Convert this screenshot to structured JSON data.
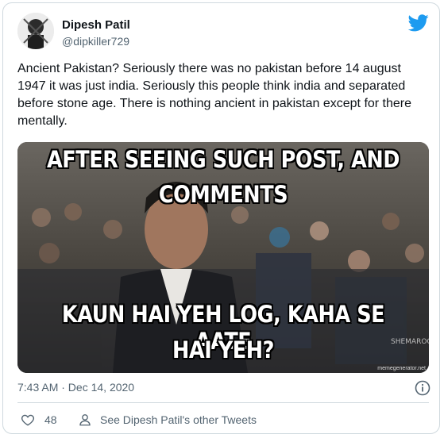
{
  "author": {
    "display_name": "Dipesh Patil",
    "handle": "@dipkiller729",
    "avatar_icon": "avatar-icon"
  },
  "brand": {
    "icon": "twitter-bird-icon",
    "color": "#1d9bf0"
  },
  "tweet": {
    "text": "Ancient Pakistan? Seriously there was no pakistan before 14 august 1947 it was just india. Seriously this people think india and separated before stone age. There is nothing ancient in pakistan except for there mentally."
  },
  "media": {
    "top_caption_line1": "AFTER SEEING SUCH POST, AND",
    "top_caption_line2": "COMMENTS",
    "bottom_caption_line1": "KAUN HAI YEH LOG, KAHA SE AATE",
    "bottom_caption_line2": "HAI YEH?",
    "overlay_mark": "SHEMAROO",
    "watermark": "memegenerator.net"
  },
  "meta": {
    "timestamp": "7:43 AM · Dec 14, 2020",
    "info_icon": "info-icon"
  },
  "actions": {
    "like_count": "48",
    "other_tweets_label": "See Dipesh Patil's other Tweets"
  }
}
